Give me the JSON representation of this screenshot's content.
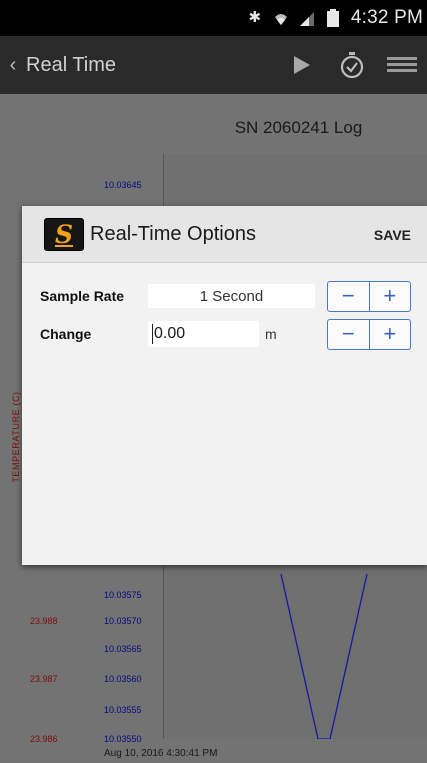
{
  "status_bar": {
    "time": "4:32 PM",
    "icons": [
      "bluetooth-icon",
      "wifi-icon",
      "signal-icon",
      "battery-icon"
    ]
  },
  "app_bar": {
    "back_icon": "chevron-left-icon",
    "title": "Real Time",
    "actions": [
      "play-icon",
      "stopwatch-icon",
      "list-view-icon"
    ]
  },
  "chart": {
    "title": "SN 2060241 Log",
    "right_axis_ticks_top": [
      "10.03645"
    ],
    "right_axis_ticks_bottom": [
      "10.03575",
      "10.03570",
      "10.03565",
      "10.03560",
      "10.03555",
      "10.03550"
    ],
    "left_axis_ticks": [
      "23.988",
      "23.987",
      "23.986"
    ],
    "left_axis_title": "TEMPERATURE (C)",
    "x_label": "Aug 10, 2016 4:30:41 PM",
    "line_color": "#1a1ab8"
  },
  "dialog": {
    "title": "Real-Time Options",
    "logo_letter": "S",
    "save_label": "SAVE",
    "sample_rate": {
      "label": "Sample Rate",
      "value": "1 Second",
      "minus": "−",
      "plus": "+"
    },
    "change": {
      "label": "Change",
      "value": "0.00",
      "unit": "m",
      "minus": "−",
      "plus": "+"
    }
  },
  "colors": {
    "accent": "#3a63b8",
    "logo": "#f4a21a"
  }
}
